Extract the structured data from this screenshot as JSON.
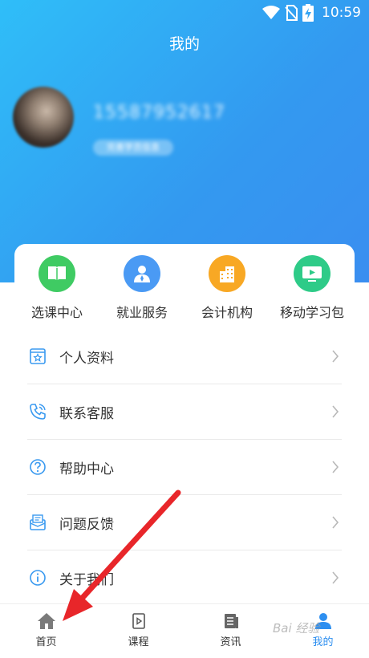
{
  "status": {
    "time": "10:59"
  },
  "page": {
    "title": "我的"
  },
  "profile": {
    "phone": "15587952617",
    "tag": "完善学员信息"
  },
  "quick_links": [
    {
      "label": "选课中心",
      "icon": "book-icon",
      "color": "#3fcb63"
    },
    {
      "label": "就业服务",
      "icon": "person-icon",
      "color": "#4a9af4"
    },
    {
      "label": "会计机构",
      "icon": "building-icon",
      "color": "#f8a824"
    },
    {
      "label": "移动学习包",
      "icon": "monitor-icon",
      "color": "#2ecb88"
    }
  ],
  "menu": [
    {
      "label": "个人资料",
      "icon": "profile-card-icon"
    },
    {
      "label": "联系客服",
      "icon": "phone-icon"
    },
    {
      "label": "帮助中心",
      "icon": "help-icon"
    },
    {
      "label": "问题反馈",
      "icon": "feedback-icon"
    },
    {
      "label": "关于我们",
      "icon": "info-icon"
    }
  ],
  "tabs": [
    {
      "label": "首页",
      "icon": "home-icon",
      "active": false
    },
    {
      "label": "课程",
      "icon": "course-icon",
      "active": false
    },
    {
      "label": "资讯",
      "icon": "news-icon",
      "active": false
    },
    {
      "label": "我的",
      "icon": "user-icon",
      "active": true
    }
  ],
  "colors": {
    "accent": "#2e8ff0",
    "annotation_arrow": "#e8262a"
  }
}
